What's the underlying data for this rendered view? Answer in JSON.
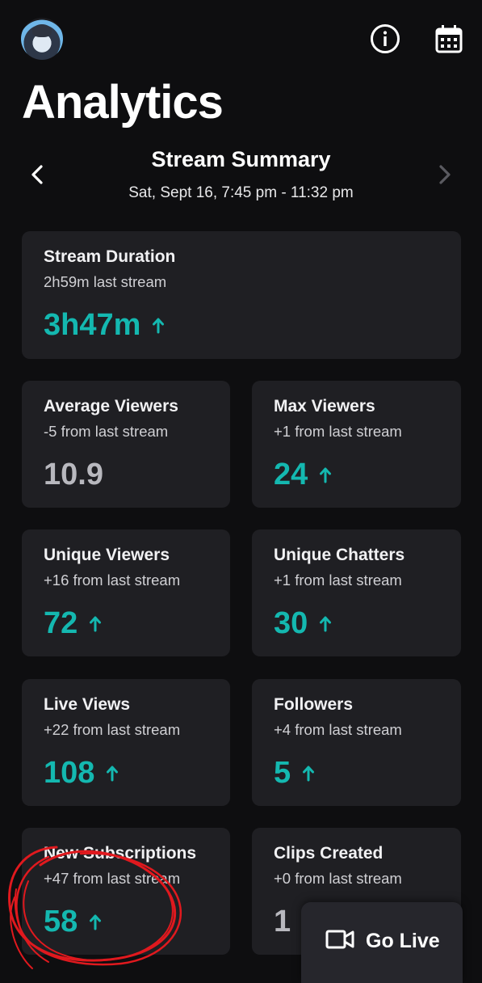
{
  "header": {
    "title": "Analytics",
    "avatar": "user-avatar",
    "info_icon": "info-icon",
    "calendar_icon": "calendar-icon"
  },
  "summary": {
    "title": "Stream Summary",
    "date_range": "Sat, Sept 16, 7:45 pm - 11:32 pm",
    "prev_icon": "chevron-left-icon",
    "next_icon": "chevron-right-icon"
  },
  "stats": {
    "stream_duration": {
      "label": "Stream Duration",
      "sub": "2h59m last stream",
      "value": "3h47m",
      "trend": "up"
    },
    "average_viewers": {
      "label": "Average Viewers",
      "sub": "-5 from last stream",
      "value": "10.9",
      "trend": "none"
    },
    "max_viewers": {
      "label": "Max Viewers",
      "sub": "+1 from last stream",
      "value": "24",
      "trend": "up"
    },
    "unique_viewers": {
      "label": "Unique Viewers",
      "sub": "+16 from last stream",
      "value": "72",
      "trend": "up"
    },
    "unique_chatters": {
      "label": "Unique Chatters",
      "sub": "+1 from last stream",
      "value": "30",
      "trend": "up"
    },
    "live_views": {
      "label": "Live Views",
      "sub": "+22 from last stream",
      "value": "108",
      "trend": "up"
    },
    "followers": {
      "label": "Followers",
      "sub": "+4 from last stream",
      "value": "5",
      "trend": "up"
    },
    "new_subscriptions": {
      "label": "New Subscriptions",
      "sub": "+47 from last stream",
      "value": "58",
      "trend": "up"
    },
    "clips_created": {
      "label": "Clips Created",
      "sub": "+0 from last stream",
      "value": "1",
      "trend": "none"
    }
  },
  "go_live": {
    "label": "Go Live",
    "icon": "video-camera-icon"
  },
  "colors": {
    "accent": "#14b8b0",
    "background": "#0e0e10",
    "card": "#1f1f23",
    "annotation": "#e0191e"
  }
}
